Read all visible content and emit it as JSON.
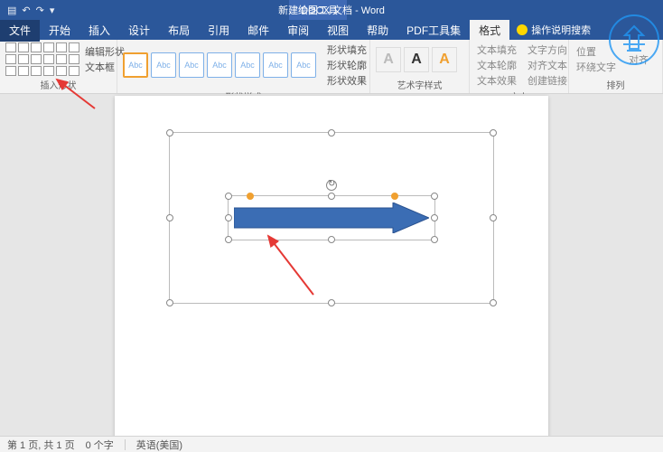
{
  "titlebar": {
    "doc_title": "新建 DOCX 文档 - Word",
    "tool_context": "绘图工具"
  },
  "tabs": {
    "file": "文件",
    "home": "开始",
    "insert": "插入",
    "design": "设计",
    "layout": "布局",
    "references": "引用",
    "mailings": "邮件",
    "review": "审阅",
    "view": "视图",
    "help": "帮助",
    "pdf": "PDF工具集",
    "format": "格式",
    "tell_me": "操作说明搜索"
  },
  "ribbon": {
    "insert_shapes": {
      "label": "插入形状",
      "edit_shape": "编辑形状",
      "text_box": "文本框"
    },
    "shape_styles": {
      "label": "形状样式",
      "sample": "Abc",
      "fill": "形状填充",
      "outline": "形状轮廓",
      "effects": "形状效果"
    },
    "wordart_styles": {
      "label": "艺术字样式",
      "glyph": "A"
    },
    "text": {
      "label": "文本",
      "fill": "文本填充",
      "outline": "文本轮廓",
      "effects": "文本效果",
      "direction": "文字方向",
      "align": "对齐文本",
      "link": "创建链接"
    },
    "arrange": {
      "label": "排列",
      "position": "位置",
      "wrap": "环绕文字",
      "align_btn": "对齐"
    }
  },
  "status": {
    "page": "第 1 页, 共 1 页",
    "words": "0 个字",
    "lang": "英语(美国)"
  }
}
